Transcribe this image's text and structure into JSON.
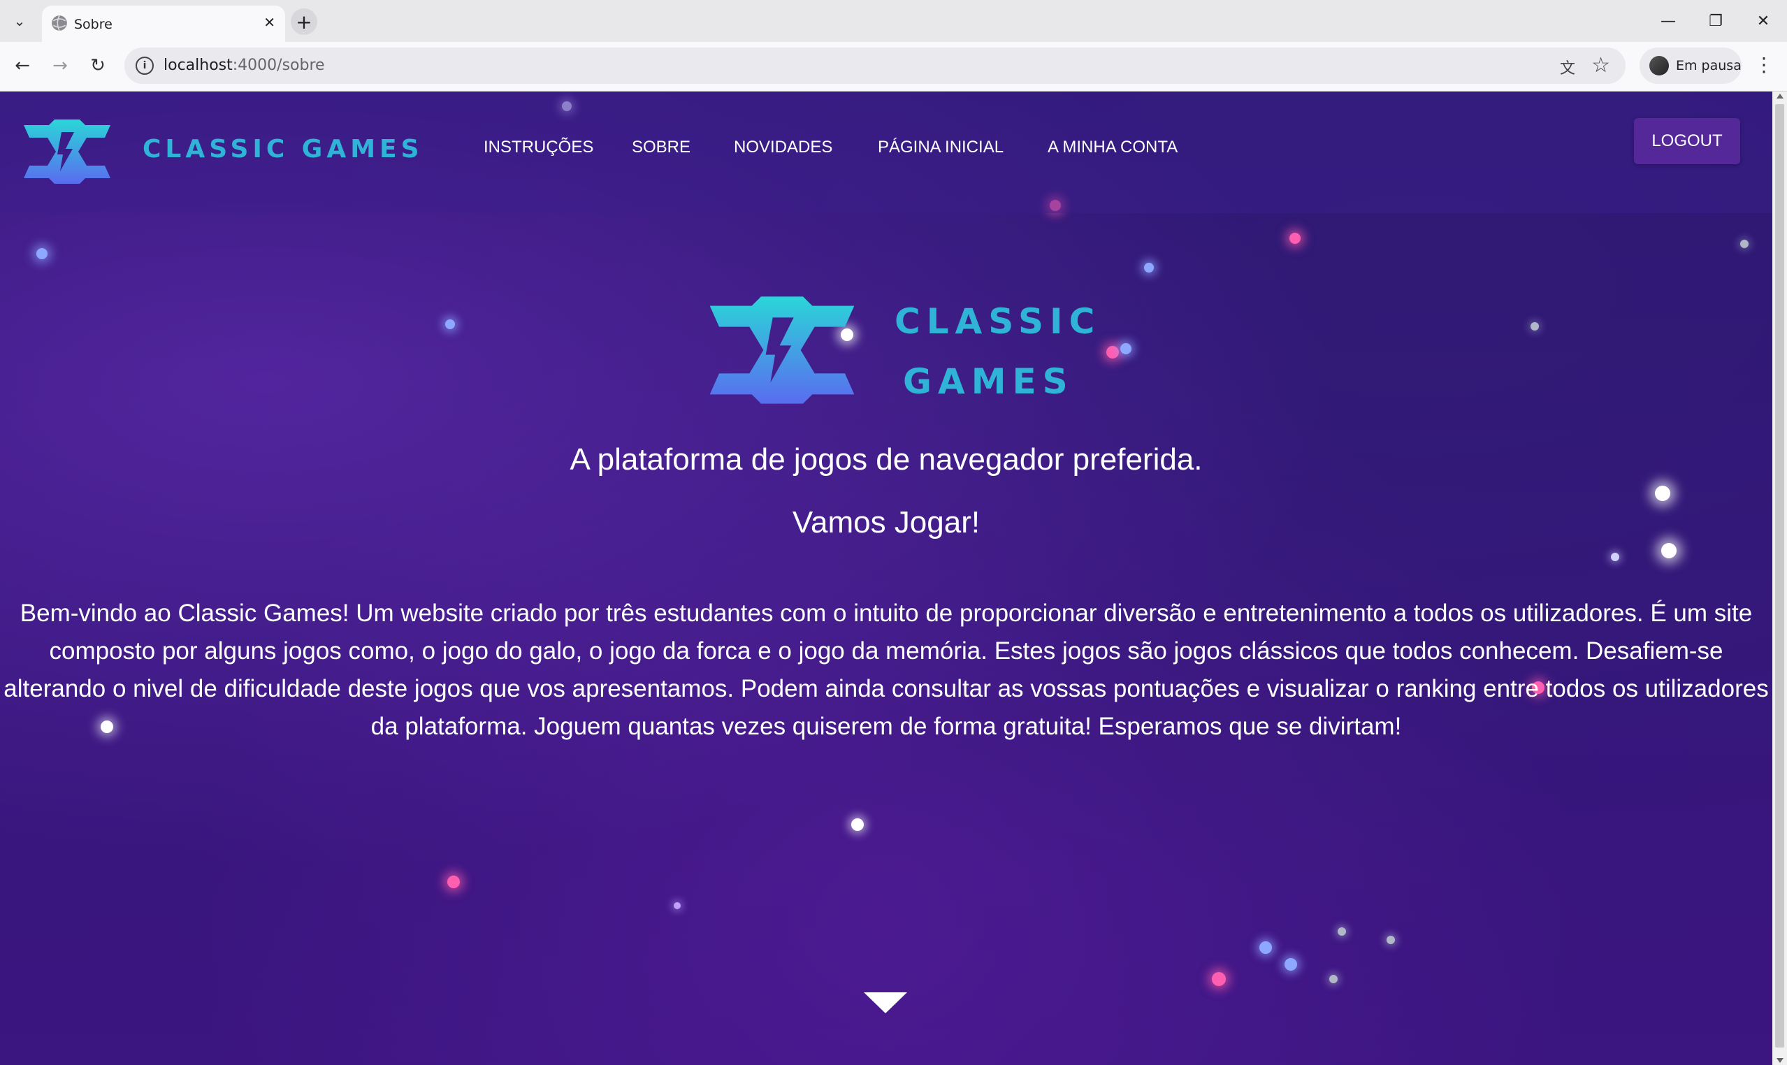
{
  "browser": {
    "tab_title": "Sobre",
    "url_host": "localhost",
    "url_rest": ":4000/sobre",
    "profile_label": "Em pausa"
  },
  "site": {
    "brand": "CLASSIC GAMES",
    "nav": [
      "INSTRUÇÕES",
      "SOBRE",
      "NOVIDADES",
      "PÁGINA INICIAL",
      "A MINHA CONTA"
    ],
    "logout_label": "LOGOUT",
    "hero_brand_line1": "CLASSIC",
    "hero_brand_line2": "GAMES",
    "tagline": "A plataforma de jogos de navegador preferida.",
    "cta_text": "Vamos Jogar!",
    "about_text": "Bem-vindo ao Classic Games! Um website criado por três estudantes com o intuito de proporcionar diversão e entretenimento a todos os utilizadores. É um site composto por alguns jogos como, o jogo do galo, o jogo da forca e o jogo da memória. Estes jogos são jogos clássicos que todos conhecem. Desafiem-se alterando o nivel de dificuldade deste jogos que vos apresentamos. Podem ainda consultar as vossas pontuações e visualizar o ranking entre todos os utilizadores da plataforma. Joguem quantas vezes quiserem de forma gratuita! Esperamos que se divirtam!"
  },
  "colors": {
    "brand_cyan": "#2fb4d8",
    "logo_gradient_top": "#2ad6d8",
    "logo_gradient_bottom": "#5a6cf0",
    "logout_bg": "#55289a",
    "page_bg": "#2b1470"
  }
}
